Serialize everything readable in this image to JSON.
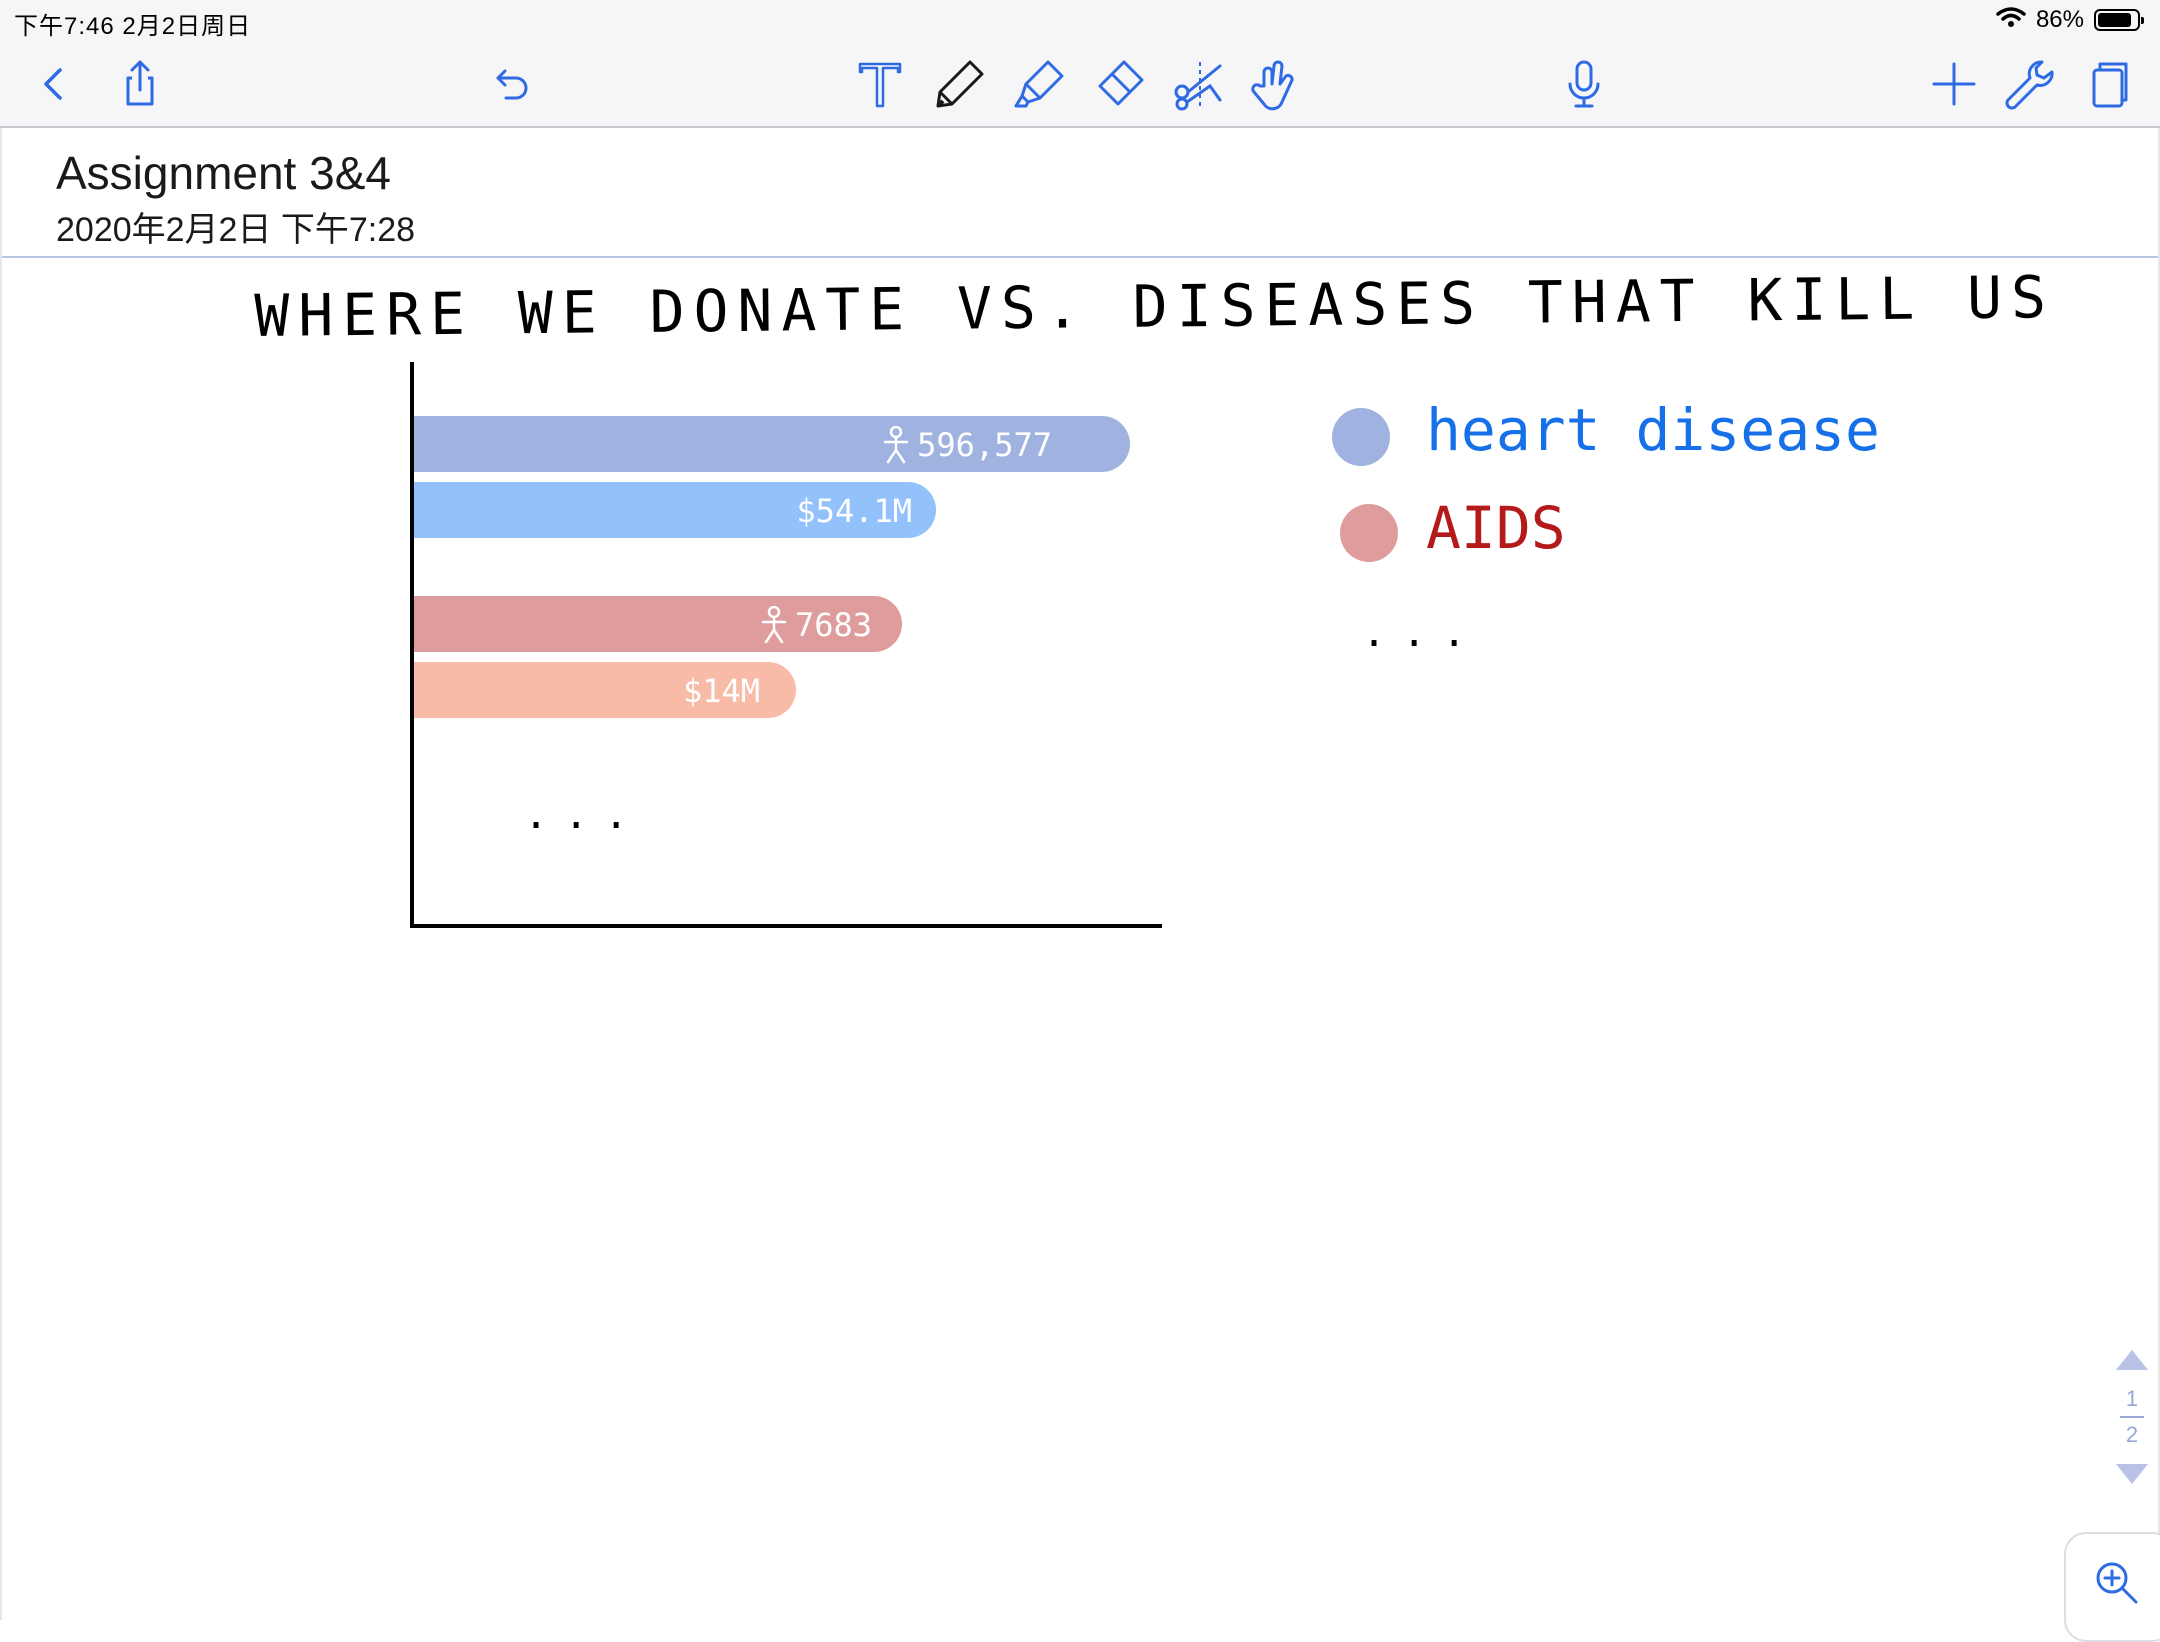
{
  "status_bar": {
    "time": "下午7:46   2月2日周日",
    "battery": "86%",
    "battery_level": 0.86
  },
  "toolbar": {
    "icons": [
      "chevron-left-icon",
      "share-icon",
      "undo-icon",
      "text-tool-icon",
      "pen-icon",
      "highlighter-icon",
      "eraser-icon",
      "scissors-icon",
      "hand-pointer-icon",
      "microphone-icon",
      "plus-icon",
      "wrench-icon",
      "pages-icon"
    ]
  },
  "note": {
    "title": "Assignment 3&4",
    "date": "2020年2月2日 下午7:28"
  },
  "chart_data": {
    "type": "bar",
    "title": "WHERE WE DONATE VS. DISEASES THAT KILL US",
    "categories": [
      "heart disease",
      "AIDS"
    ],
    "series": [
      {
        "metric": "deaths",
        "values": [
          596577,
          7683
        ],
        "labels": [
          "596,577",
          "7683"
        ]
      },
      {
        "metric": "donations",
        "values": [
          54.1,
          14
        ],
        "labels": [
          "$54.1M",
          "$14M"
        ]
      }
    ],
    "colors": {
      "heart_deaths": "#a0b2e0",
      "heart_donations": "#92c1fb",
      "aids_deaths": "#df9c9d",
      "aids_donations": "#f8bba8"
    },
    "more_marker": "...",
    "legend": [
      {
        "label": "heart disease",
        "dot_color": "#a0b2e0",
        "text_color": "#1570ea"
      },
      {
        "label": "AIDS",
        "dot_color": "#df9c9d",
        "text_color": "#b51a1a"
      }
    ],
    "legend_more": "...",
    "legend_position": "right",
    "grid": false
  },
  "pager": {
    "current": "1",
    "total": "2"
  }
}
